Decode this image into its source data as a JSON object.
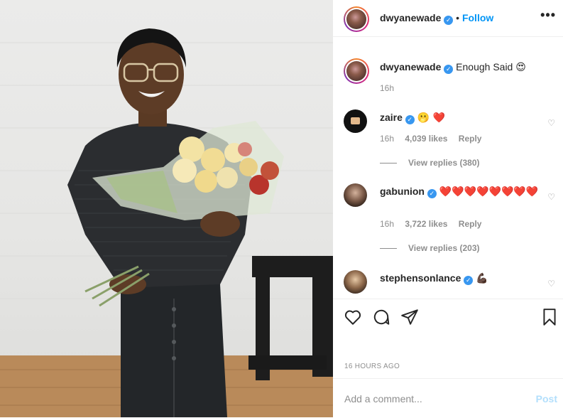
{
  "post": {
    "username": "dwyanewade",
    "verified_mark": "✓",
    "separator": "•",
    "follow_label": "Follow",
    "more_icon": "•••",
    "caption": "Enough Said 😍",
    "caption_time": "16h",
    "timestamp": "16 HOURS AGO"
  },
  "comments": [
    {
      "username": "zaire",
      "text": "🫢 ❤️",
      "time": "16h",
      "likes": "4,039 likes",
      "reply_label": "Reply",
      "view_replies": "View replies (380)"
    },
    {
      "username": "gabunion",
      "text": "❤️❤️❤️❤️❤️❤️❤️❤️",
      "time": "16h",
      "likes": "3,722 likes",
      "reply_label": "Reply",
      "view_replies": "View replies (203)"
    },
    {
      "username": "stephensonlance",
      "text": "💪🏿"
    }
  ],
  "add_comment": {
    "placeholder": "Add a comment...",
    "post_label": "Post"
  },
  "colors": {
    "link_blue": "#0095f6",
    "verified_blue": "#3897f0",
    "muted": "#8e8e8e",
    "post_disabled": "#b2dffc"
  }
}
